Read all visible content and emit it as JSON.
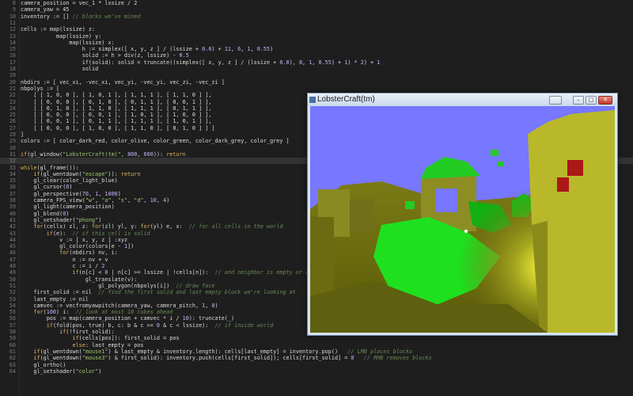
{
  "editor": {
    "current_line": 32,
    "lines": [
      {
        "n": "8",
        "t": [
          [
            "camera_position = vec_1 * lssize / 2",
            "var"
          ]
        ]
      },
      {
        "n": "9",
        "t": [
          [
            "camera_yaw = 45",
            "var"
          ]
        ]
      },
      {
        "n": "10",
        "t": [
          [
            "inventory := [] ",
            "var"
          ],
          [
            "// blocks we've mined",
            "cmt"
          ]
        ]
      },
      {
        "n": "11",
        "t": []
      },
      {
        "n": "12",
        "t": [
          [
            "cells := map(lssize) z:",
            "var"
          ]
        ]
      },
      {
        "n": "13",
        "t": [
          [
            "           map(lssize) y:",
            "var"
          ]
        ]
      },
      {
        "n": "14",
        "t": [
          [
            "               map(lssize) x:",
            "var"
          ]
        ]
      },
      {
        "n": "15",
        "t": [
          [
            "                   h := simplex([ x, y, z ] / (lssize + ",
            "var"
          ],
          [
            "0.0",
            "num"
          ],
          [
            ") + ",
            "var"
          ],
          [
            "11",
            "num"
          ],
          [
            ", ",
            "var"
          ],
          [
            "6",
            "num"
          ],
          [
            ", ",
            "var"
          ],
          [
            "1",
            "num"
          ],
          [
            ", ",
            "var"
          ],
          [
            "0.55",
            "num"
          ],
          [
            ")",
            "var"
          ]
        ]
      },
      {
        "n": "16",
        "t": [
          [
            "                   solid := h > div(z, lssize) - ",
            "var"
          ],
          [
            "0.5",
            "num"
          ]
        ]
      },
      {
        "n": "17",
        "t": [
          [
            "                   if(solid): solid = truncate((simplex([ x, y, z ] / (lssize + ",
            "var"
          ],
          [
            "0.0",
            "num"
          ],
          [
            "), ",
            "var"
          ],
          [
            "8",
            "num"
          ],
          [
            ", ",
            "var"
          ],
          [
            "1",
            "num"
          ],
          [
            ", ",
            "var"
          ],
          [
            "0.55",
            "num"
          ],
          [
            ") + ",
            "var"
          ],
          [
            "1",
            "num"
          ],
          [
            ") * ",
            "var"
          ],
          [
            "2",
            "num"
          ],
          [
            ") + ",
            "var"
          ],
          [
            "1",
            "num"
          ]
        ]
      },
      {
        "n": "18",
        "t": [
          [
            "                   solid",
            "var"
          ]
        ]
      },
      {
        "n": "19",
        "t": []
      },
      {
        "n": "20",
        "t": [
          [
            "nbdirs := [ vec_xi, -vec_xi, vec_yi, -vec_yi, vec_zi, -vec_zi ]",
            "var"
          ]
        ]
      },
      {
        "n": "21",
        "t": [
          [
            "nbpolys := [",
            "var"
          ]
        ]
      },
      {
        "n": "22",
        "t": [
          [
            "    [ [ 1, 0, 0 ], [ 1, 0, 1 ], [ 1, 1, 1 ], [ 1, 1, 0 ] ],",
            "var"
          ]
        ]
      },
      {
        "n": "23",
        "t": [
          [
            "    [ [ 0, 0, 0 ], [ 0, 1, 0 ], [ 0, 1, 1 ], [ 0, 0, 1 ] ],",
            "var"
          ]
        ]
      },
      {
        "n": "24",
        "t": [
          [
            "    [ [ 0, 1, 0 ], [ 1, 1, 0 ], [ 1, 1, 1 ], [ 0, 1, 1 ] ],",
            "var"
          ]
        ]
      },
      {
        "n": "25",
        "t": [
          [
            "    [ [ 0, 0, 0 ], [ 0, 0, 1 ], [ 1, 0, 1 ], [ 1, 0, 0 ] ],",
            "var"
          ]
        ]
      },
      {
        "n": "26",
        "t": [
          [
            "    [ [ 0, 0, 1 ], [ 0, 1, 1 ], [ 1, 1, 1 ], [ 1, 0, 1 ] ],",
            "var"
          ]
        ]
      },
      {
        "n": "27",
        "t": [
          [
            "    [ [ 0, 0, 0 ], [ 1, 0, 0 ], [ 1, 1, 0 ], [ 0, 1, 0 ] ] ]",
            "var"
          ]
        ]
      },
      {
        "n": "28",
        "t": [
          [
            "]",
            "var"
          ]
        ]
      },
      {
        "n": "29",
        "t": [
          [
            "colors := [ color_dark_red, color_olive, color_green, color_dark_grey, color_grey ]",
            "var"
          ]
        ]
      },
      {
        "n": "30",
        "t": []
      },
      {
        "n": "31",
        "t": [
          [
            "if",
            "kw"
          ],
          [
            "(gl_window(",
            "var"
          ],
          [
            "\"LobsterCraft(tm)\"",
            "str"
          ],
          [
            ", ",
            "var"
          ],
          [
            "800",
            "num"
          ],
          [
            ", ",
            "var"
          ],
          [
            "600",
            "num"
          ],
          [
            ")): ",
            "var"
          ],
          [
            "return",
            "kw"
          ]
        ]
      },
      {
        "n": "32",
        "t": []
      },
      {
        "n": "33",
        "t": [
          [
            "while",
            "kw"
          ],
          [
            "(gl_frame()):",
            "var"
          ]
        ]
      },
      {
        "n": "34",
        "t": [
          [
            "    ",
            "var"
          ],
          [
            "if",
            "kw"
          ],
          [
            "(gl_wentdown(",
            "var"
          ],
          [
            "\"escape\"",
            "str"
          ],
          [
            ")): ",
            "var"
          ],
          [
            "return",
            "kw"
          ]
        ]
      },
      {
        "n": "35",
        "t": [
          [
            "    gl_clear(color_light_blue)",
            "var"
          ]
        ]
      },
      {
        "n": "36",
        "t": [
          [
            "    gl_cursor(",
            "var"
          ],
          [
            "0",
            "num"
          ],
          [
            ")",
            "var"
          ]
        ]
      },
      {
        "n": "37",
        "t": [
          [
            "    gl_perspective(",
            "var"
          ],
          [
            "70",
            "num"
          ],
          [
            ", ",
            "var"
          ],
          [
            "1",
            "num"
          ],
          [
            ", ",
            "var"
          ],
          [
            "1000",
            "num"
          ],
          [
            ")",
            "var"
          ]
        ]
      },
      {
        "n": "38",
        "t": [
          [
            "    camera_FPS_view(",
            "var"
          ],
          [
            "\"w\"",
            "str"
          ],
          [
            ", ",
            "var"
          ],
          [
            "\"a\"",
            "str"
          ],
          [
            ", ",
            "var"
          ],
          [
            "\"s\"",
            "str"
          ],
          [
            ", ",
            "var"
          ],
          [
            "\"d\"",
            "str"
          ],
          [
            ", ",
            "var"
          ],
          [
            "10",
            "num"
          ],
          [
            ", ",
            "var"
          ],
          [
            "4",
            "num"
          ],
          [
            ")",
            "var"
          ]
        ]
      },
      {
        "n": "39",
        "t": [
          [
            "    gl_light(camera_position)",
            "var"
          ]
        ]
      },
      {
        "n": "40",
        "t": [
          [
            "    gl_blend(",
            "var"
          ],
          [
            "0",
            "num"
          ],
          [
            ")",
            "var"
          ]
        ]
      },
      {
        "n": "41",
        "t": [
          [
            "    gl_setshader(",
            "var"
          ],
          [
            "\"phong\"",
            "str"
          ],
          [
            ")",
            "var"
          ]
        ]
      },
      {
        "n": "42",
        "t": [
          [
            "    ",
            "var"
          ],
          [
            "for",
            "kw"
          ],
          [
            "(cells) zl, z: ",
            "var"
          ],
          [
            "for",
            "kw"
          ],
          [
            "(zl) yl, y: ",
            "var"
          ],
          [
            "for",
            "kw"
          ],
          [
            "(yl) e, x:  ",
            "var"
          ],
          [
            "// for all cells in the world",
            "cmt"
          ]
        ]
      },
      {
        "n": "43",
        "t": [
          [
            "        ",
            "var"
          ],
          [
            "if",
            "kw"
          ],
          [
            "(e):  ",
            "var"
          ],
          [
            "// if this cell is solid",
            "cmt"
          ]
        ]
      },
      {
        "n": "44",
        "t": [
          [
            "            v := [ x, y, z ] :xyz",
            "var"
          ]
        ]
      },
      {
        "n": "45",
        "t": [
          [
            "            gl_color(colors[e - ",
            "var"
          ],
          [
            "1",
            "num"
          ],
          [
            "])",
            "var"
          ]
        ]
      },
      {
        "n": "46",
        "t": [
          [
            "            ",
            "var"
          ],
          [
            "for",
            "kw"
          ],
          [
            "(nbdirs) nv, i:",
            "var"
          ]
        ]
      },
      {
        "n": "47",
        "t": [
          [
            "                n := nv + v",
            "var"
          ]
        ]
      },
      {
        "n": "48",
        "t": [
          [
            "                c := i / ",
            "var"
          ],
          [
            "2",
            "num"
          ]
        ]
      },
      {
        "n": "49",
        "t": [
          [
            "                ",
            "var"
          ],
          [
            "if",
            "kw"
          ],
          [
            "(n[c] < ",
            "var"
          ],
          [
            "0",
            "num"
          ],
          [
            " | n[c] >= lssize | !cells[n]):  ",
            "var"
          ],
          [
            "// and neighbor is empty or outside the world",
            "cmt"
          ]
        ]
      },
      {
        "n": "50",
        "t": [
          [
            "                    gl_translate(v):",
            "var"
          ]
        ]
      },
      {
        "n": "51",
        "t": [
          [
            "                        gl_polygon(nbpolys[i])  ",
            "var"
          ],
          [
            "// draw face",
            "cmt"
          ]
        ]
      },
      {
        "n": "52",
        "t": [
          [
            "    first_solid := nil  ",
            "var"
          ],
          [
            "// find the first solid and last empty block we're looking at",
            "cmt"
          ]
        ]
      },
      {
        "n": "53",
        "t": [
          [
            "    last_empty := nil",
            "var"
          ]
        ]
      },
      {
        "n": "54",
        "t": [
          [
            "    camvec := vecfromyawpitch(camera_yaw, camera_pitch, ",
            "var"
          ],
          [
            "1",
            "num"
          ],
          [
            ", ",
            "var"
          ],
          [
            "0",
            "num"
          ],
          [
            ")",
            "var"
          ]
        ]
      },
      {
        "n": "55",
        "t": [
          [
            "    ",
            "var"
          ],
          [
            "for",
            "kw"
          ],
          [
            "(",
            "var"
          ],
          [
            "100",
            "num"
          ],
          [
            ") i:  ",
            "var"
          ],
          [
            "// look at most 10 cubes ahead",
            "cmt"
          ]
        ]
      },
      {
        "n": "56",
        "t": [
          [
            "        pos := map(camera_position + camvec * i / ",
            "var"
          ],
          [
            "10",
            "num"
          ],
          [
            "): truncate(_)",
            "var"
          ]
        ]
      },
      {
        "n": "57",
        "t": [
          [
            "        ",
            "var"
          ],
          [
            "if",
            "kw"
          ],
          [
            "(fold(pos, true) b, c: b & c >= ",
            "var"
          ],
          [
            "0",
            "num"
          ],
          [
            " & c < lssize):  ",
            "var"
          ],
          [
            "// if inside world",
            "cmt"
          ]
        ]
      },
      {
        "n": "58",
        "t": [
          [
            "            ",
            "var"
          ],
          [
            "if",
            "kw"
          ],
          [
            "(!first_solid):",
            "var"
          ]
        ]
      },
      {
        "n": "59",
        "t": [
          [
            "                ",
            "var"
          ],
          [
            "if",
            "kw"
          ],
          [
            "(cells[pos]): first_solid = pos",
            "var"
          ]
        ]
      },
      {
        "n": "60",
        "t": [
          [
            "                ",
            "var"
          ],
          [
            "else",
            "kw"
          ],
          [
            ": last_empty = pos",
            "var"
          ]
        ]
      },
      {
        "n": "61",
        "t": [
          [
            "    ",
            "var"
          ],
          [
            "if",
            "kw"
          ],
          [
            "(gl_wentdown(",
            "var"
          ],
          [
            "\"mouse1\"",
            "str"
          ],
          [
            ") & last_empty & inventory.length): cells[last_empty] = inventory.pop()   ",
            "var"
          ],
          [
            "// LMB places blocks",
            "cmt"
          ]
        ]
      },
      {
        "n": "62",
        "t": [
          [
            "    ",
            "var"
          ],
          [
            "if",
            "kw"
          ],
          [
            "(gl_wentdown(",
            "var"
          ],
          [
            "\"mouse3\"",
            "str"
          ],
          [
            ") & first_solid): inventory.push(cells[first_solid]); cells[first_solid] = ",
            "var"
          ],
          [
            "0",
            "num"
          ],
          [
            "   ",
            "var"
          ],
          [
            "// RMB removes blocks",
            "cmt"
          ]
        ]
      },
      {
        "n": "63",
        "t": [
          [
            "    gl_ortho()",
            "var"
          ]
        ]
      },
      {
        "n": "64",
        "t": [
          [
            "    gl_setshader(",
            "var"
          ],
          [
            "\"color\"",
            "str"
          ],
          [
            ")",
            "var"
          ]
        ]
      }
    ]
  },
  "window": {
    "title": "LobsterCraft(tm)",
    "min_label": "–",
    "max_label": "□",
    "close_label": "✕",
    "sky_color": "#7777ff"
  },
  "icons": [
    "app-icon",
    "minimize-icon",
    "maximize-icon",
    "close-icon",
    "crosshair-icon"
  ]
}
